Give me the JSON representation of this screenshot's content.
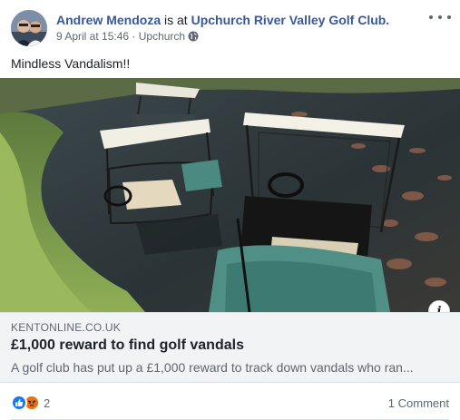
{
  "post": {
    "author": "Andrew Mendoza",
    "checkin_text": " is at ",
    "place": "Upchurch River Valley Golf Club.",
    "date": "9 April at 15:46",
    "separator": " · ",
    "location": "Upchurch",
    "audience_icon": "globe-icon",
    "text": "Mindless Vandalism!!"
  },
  "link_preview": {
    "image_description_icon": "golf-carts-in-pond-image",
    "info_label": "i",
    "domain": "KENTONLINE.CO.UK",
    "title": "£1,000 reward to find golf vandals",
    "description": "A golf club has put up a £1,000 reward to track down vandals who ran..."
  },
  "footer": {
    "reaction_icons": [
      "like-icon",
      "angry-icon"
    ],
    "reaction_count": "2",
    "comment_count_label": "1 Comment"
  },
  "colors": {
    "link_blue": "#385898",
    "secondary_text": "#606770",
    "like_blue": "#1877f2",
    "angry_orange": "#f0763a",
    "preview_bg": "#f2f3f5"
  }
}
